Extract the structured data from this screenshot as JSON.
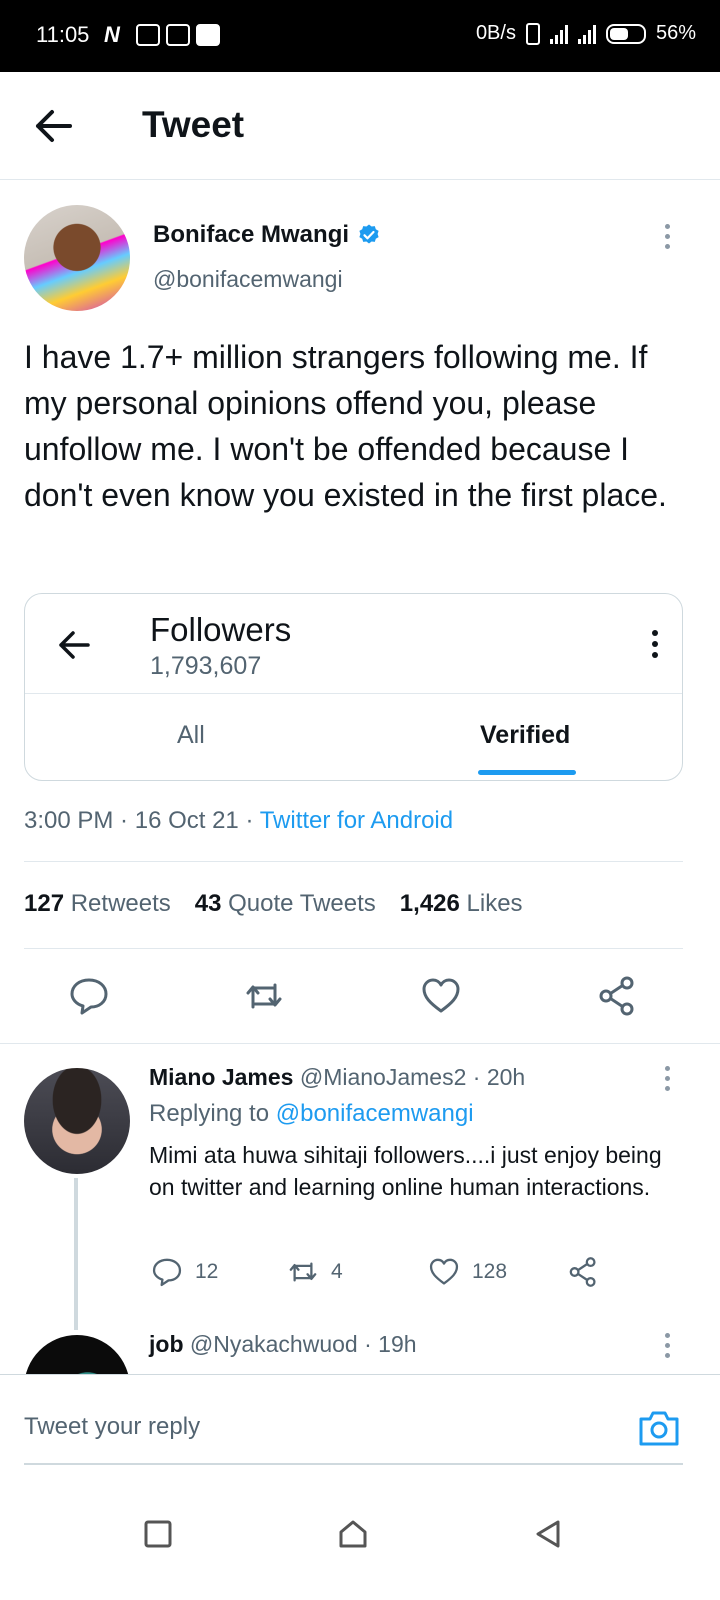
{
  "status_bar": {
    "time": "11:05",
    "net_speed": "0B/s",
    "battery": "56%",
    "icons": [
      "n-icon",
      "gallery-icon",
      "pulse-icon",
      "youtube-icon",
      "sim-icon",
      "signal-icon",
      "signal-icon",
      "battery-icon"
    ]
  },
  "header": {
    "title": "Tweet"
  },
  "tweet": {
    "author_name": "Boniface Mwangi",
    "author_handle": "@bonifacemwangi",
    "text": "I have 1.7+ million strangers following me. If my personal opinions offend you, please unfollow me. I won't be offended because I don't even know you existed in the first place.",
    "card": {
      "title": "Followers",
      "count": "1,793,607",
      "tabs": [
        "All",
        "Verified"
      ],
      "active_tab": "Verified"
    },
    "meta": {
      "time": "3:00 PM",
      "date": "16 Oct 21",
      "source": "Twitter for Android",
      "separator": " · "
    },
    "stats": {
      "retweets_count": "127",
      "retweets_label": "Retweets",
      "quotes_count": "43",
      "quotes_label": "Quote Tweets",
      "likes_count": "1,426",
      "likes_label": "Likes"
    }
  },
  "replies": [
    {
      "name": "Miano James",
      "handle": "@MianoJames2",
      "age": "20h",
      "replying_label": "Replying to",
      "replying_to": "@bonifacemwangi",
      "text": "Mimi ata huwa sihitaji followers....i just enjoy being on twitter and learning online human interactions.",
      "reply_count": "12",
      "retweet_count": "4",
      "like_count": "128"
    },
    {
      "name": "job",
      "handle": "@Nyakachwuod",
      "age": "19h"
    }
  ],
  "reply_bar": {
    "placeholder": "Tweet your reply"
  },
  "colors": {
    "accent": "#1d9bf0",
    "text": "#0f1419",
    "muted": "#536471",
    "border": "#e1e8ed"
  }
}
